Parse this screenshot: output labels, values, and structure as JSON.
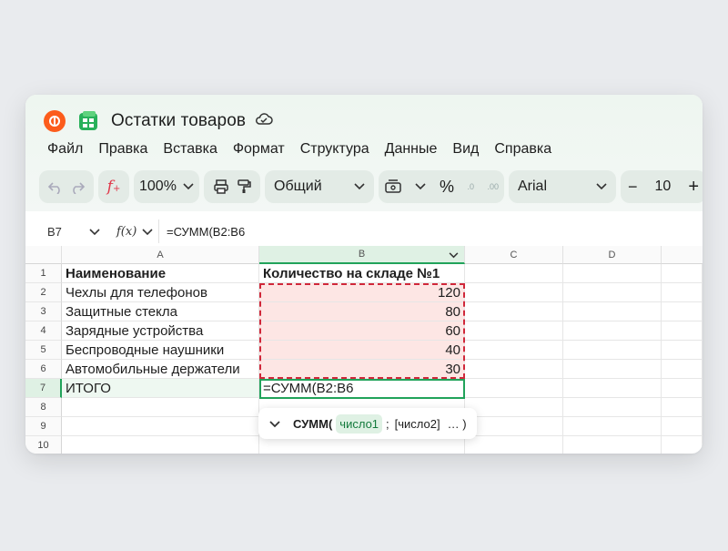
{
  "app": {
    "title": "Остатки товаров",
    "logo_icon": "yandex-logo-icon",
    "app_icon": "tables-app-icon",
    "brand_color": "#fc5c1c",
    "accent_color": "#21a35a"
  },
  "menu": [
    "Файл",
    "Правка",
    "Вставка",
    "Формат",
    "Структура",
    "Данные",
    "Вид",
    "Справка"
  ],
  "toolbar": {
    "zoom": "100%",
    "format": "Общий",
    "percent": "%",
    "font": "Arial",
    "font_size": "10",
    "minus": "−",
    "plus": "+",
    "dec_decrease": ".0",
    "dec_increase": ".00"
  },
  "formula_bar": {
    "cell_ref": "B7",
    "fx_label": "f(x)",
    "formula": "=СУММ(B2:B6"
  },
  "columns": [
    "A",
    "B",
    "C",
    "D"
  ],
  "rows": [
    "1",
    "2",
    "3",
    "4",
    "5",
    "6",
    "7",
    "8",
    "9",
    "10"
  ],
  "sheet": {
    "a": [
      "Наименование",
      "Чехлы для телефонов",
      "Защитные стекла",
      "Зарядные устройства",
      "Беспроводные наушники",
      "Автомобильные держатели",
      "ИТОГО",
      "",
      "",
      ""
    ],
    "b": [
      "Количество на складе №1",
      "120",
      "80",
      "60",
      "40",
      "30",
      "=СУММ(B2:B6",
      "",
      "",
      ""
    ]
  },
  "hint": {
    "func": "СУММ(",
    "arg1": "число1",
    "sep": ";",
    "arg2": "[число2]",
    "rest": "… )"
  }
}
